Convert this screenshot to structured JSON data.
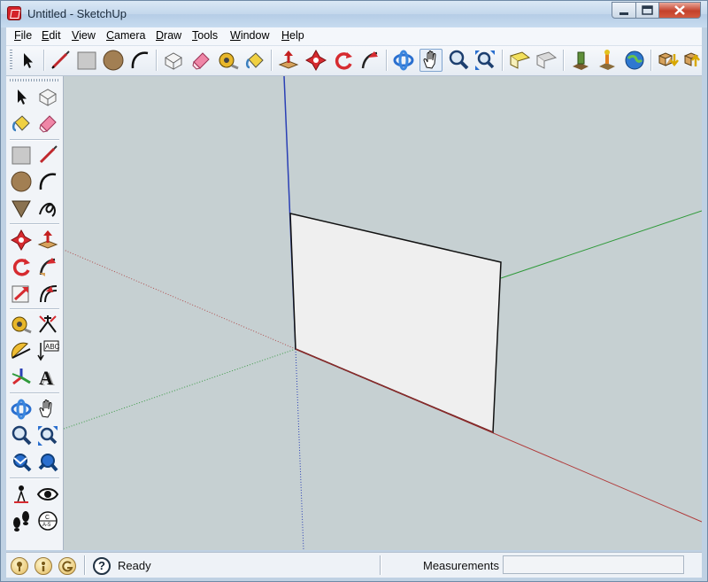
{
  "window": {
    "title": "Untitled - SketchUp"
  },
  "menu": {
    "items": [
      {
        "u": "F",
        "rest": "ile"
      },
      {
        "u": "E",
        "rest": "dit"
      },
      {
        "u": "V",
        "rest": "iew"
      },
      {
        "u": "C",
        "rest": "amera"
      },
      {
        "u": "D",
        "rest": "raw"
      },
      {
        "u": "T",
        "rest": "ools"
      },
      {
        "u": "W",
        "rest": "indow"
      },
      {
        "u": "H",
        "rest": "elp"
      }
    ]
  },
  "toolbar_tools": [
    "select-icon",
    "line-icon",
    "rectangle-icon",
    "circle-icon",
    "arc-icon",
    "make-component-icon",
    "eraser-icon",
    "tape-measure-icon",
    "paint-bucket-icon",
    "push-pull-icon",
    "move-icon",
    "rotate-icon",
    "follow-me-icon",
    "orbit-icon",
    "pan-icon",
    "zoom-icon",
    "zoom-extents-icon",
    "previous-view-icon",
    "next-view-icon",
    "add-location-icon",
    "toggle-terrain-icon",
    "google-earth-icon",
    "get-models-icon",
    "share-model-icon"
  ],
  "colors": {
    "axis_red": "#b03a3a",
    "axis_green": "#2f9a3a",
    "axis_blue": "#2a3fb5",
    "face": "#efefef",
    "sky": "#c6d0d2"
  },
  "status": {
    "text": "Ready",
    "help_glyph": "?",
    "measurements_label": "Measurements",
    "measurements_value": ""
  },
  "status_icons": [
    "geo-location-icon",
    "credits-icon",
    "google-sign-in-icon"
  ]
}
